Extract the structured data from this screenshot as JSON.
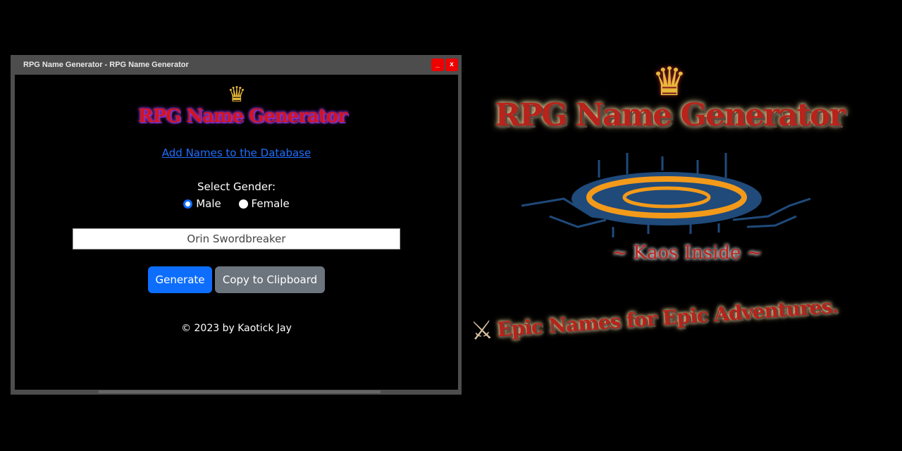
{
  "window": {
    "title": "RPG Name Generator - RPG Name Generator",
    "minimize_label": "_",
    "close_label": "x"
  },
  "app": {
    "logo_text": "RPG Name Generator",
    "add_names_link": "Add Names to the Database",
    "gender_label": "Select Gender:",
    "gender_options": [
      {
        "label": "Male",
        "selected": true
      },
      {
        "label": "Female",
        "selected": false
      }
    ],
    "name_value": "Orin Swordbreaker",
    "generate_label": "Generate",
    "copy_label": "Copy to Clipboard",
    "footer": "© 2023 by Kaotick Jay",
    "colors": {
      "primary": "#0d6efd",
      "secondary": "#6c757d",
      "link": "#1e6fff"
    }
  },
  "banner": {
    "logo_text": "RPG Name Generator",
    "subtitle": "~ Kaos Inside ~",
    "tagline": "Epic Names for Epic Adventures."
  }
}
